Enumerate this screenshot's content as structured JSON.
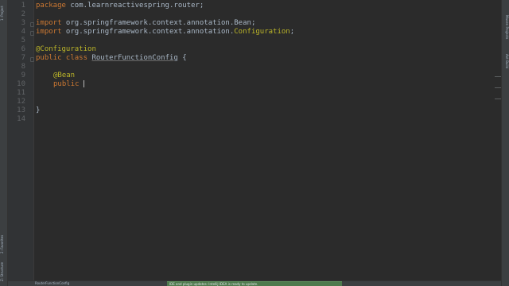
{
  "left_tool_tabs": [
    "1: Project",
    "2: Favorites",
    "Z: Structure"
  ],
  "right_tool_tabs": [
    "Maven Projects",
    "Ant Build"
  ],
  "line_numbers": [
    "1",
    "2",
    "3",
    "4",
    "5",
    "6",
    "7",
    "8",
    "9",
    "10",
    "11",
    "12",
    "13",
    "14"
  ],
  "code": {
    "line1": {
      "kw": "package",
      "rest": " com.learnreactivespring.router;"
    },
    "line3": {
      "kw": "import",
      "rest": " org.springframework.context.annotation.",
      "cls": "Bean",
      "end": ";"
    },
    "line4": {
      "kw": "import",
      "rest": " org.springframework.context.annotation.",
      "cls": "Configuration",
      "end": ";"
    },
    "line6": {
      "ann": "@Configuration"
    },
    "line7": {
      "kw": "public class",
      "cls": "RouterFunctionConfig",
      "end": " {"
    },
    "line9": {
      "ann": "@Bean"
    },
    "line10": {
      "kw": "public"
    },
    "line14": {
      "text": "}"
    }
  },
  "breadcrumb": "RouterFunctionConfig",
  "notification": "IDE and plugin updates: IntelliJ IDEA is ready to update."
}
